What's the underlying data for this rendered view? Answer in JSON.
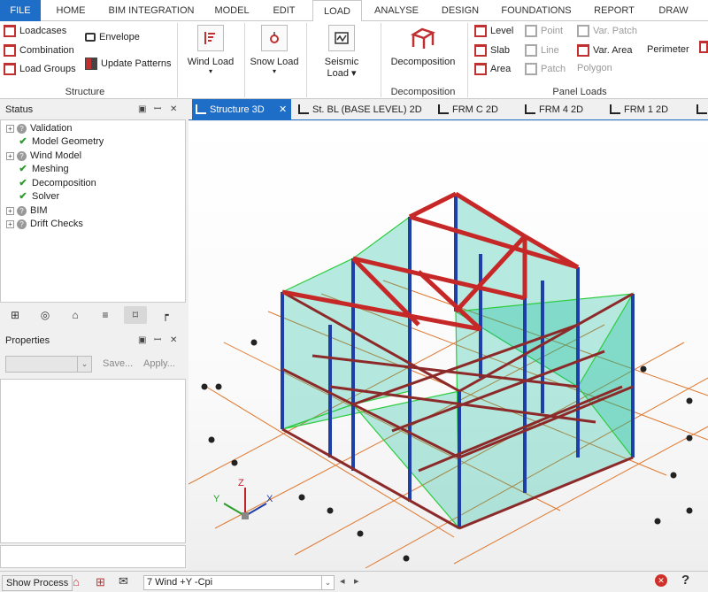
{
  "menu": {
    "tabs": [
      "FILE",
      "HOME",
      "BIM INTEGRATION",
      "MODEL",
      "EDIT",
      "LOAD",
      "ANALYSE",
      "DESIGN",
      "FOUNDATIONS",
      "REPORT",
      "DRAW"
    ],
    "active": "LOAD"
  },
  "ribbon": {
    "structure": {
      "loadcases": "Loadcases",
      "combination": "Combination",
      "load_groups": "Load Groups",
      "envelope": "Envelope",
      "update_patterns": "Update Patterns",
      "group_label": "Structure"
    },
    "wind_load": "Wind Load",
    "snow_load": "Snow Load",
    "seismic_load_1": "Seismic",
    "seismic_load_2": "Load",
    "decomposition": {
      "button": "Decomposition",
      "group_label": "Decomposition"
    },
    "panel_loads": {
      "level": "Level",
      "slab": "Slab",
      "area": "Area",
      "point": "Point",
      "line": "Line",
      "patch": "Patch",
      "var_patch": "Var. Patch",
      "var_area": "Var. Area",
      "polygon": "Polygon",
      "perimeter": "Perimeter",
      "group_label": "Panel Loads"
    }
  },
  "status_pane": {
    "title": "Status",
    "items": [
      {
        "label": "Validation",
        "state": "unknown",
        "expandable": true
      },
      {
        "label": "Model Geometry",
        "state": "ok",
        "expandable": false
      },
      {
        "label": "Wind Model",
        "state": "unknown",
        "expandable": true
      },
      {
        "label": "Meshing",
        "state": "ok",
        "expandable": false
      },
      {
        "label": "Decomposition",
        "state": "ok",
        "expandable": false
      },
      {
        "label": "Solver",
        "state": "ok",
        "expandable": false
      },
      {
        "label": "BIM",
        "state": "unknown",
        "expandable": true
      },
      {
        "label": "Drift Checks",
        "state": "unknown",
        "expandable": true
      }
    ]
  },
  "properties_pane": {
    "title": "Properties",
    "save": "Save...",
    "apply": "Apply..."
  },
  "doc_tabs": [
    "Structure 3D",
    "St. BL (BASE LEVEL) 2D",
    "FRM C 2D",
    "FRM 4 2D",
    "FRM 1 2D"
  ],
  "axes": {
    "x": "X",
    "y": "Y",
    "z": "Z"
  },
  "statusbar": {
    "show_process": "Show Process",
    "loadcase": "7 Wind +Y -Cpi"
  },
  "colors": {
    "accent": "#1e6ec8",
    "member_red": "#c03030",
    "column_blue": "#1f3fa8",
    "panel_green": "#00b894",
    "grid_orange": "#e0782f"
  }
}
